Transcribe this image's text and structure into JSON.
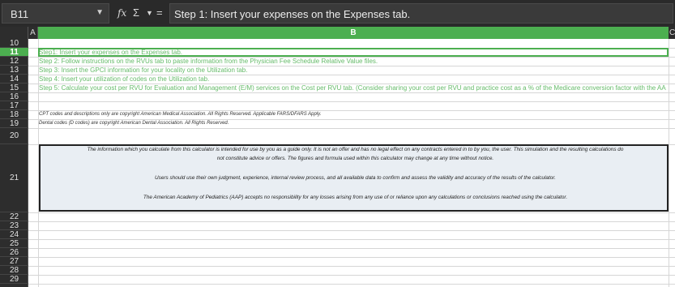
{
  "formula_bar": {
    "name_box": "B11",
    "content": "Step 1: Insert your expenses on the Expenses tab."
  },
  "columns": [
    "A",
    "B",
    "C"
  ],
  "rows": [
    "10",
    "11",
    "12",
    "13",
    "14",
    "15",
    "16",
    "17",
    "18",
    "19",
    "20",
    "21",
    "22",
    "23",
    "24",
    "25",
    "26",
    "27",
    "28",
    "29"
  ],
  "selected_row": "11",
  "cells": {
    "r11": "Step1: Insert your expenses on the Expenses tab.",
    "r12": "Step 2: Follow instructions on the RVUs tab to paste information from the Physician Fee Schedule Relative Value files.",
    "r13": "Step 3: Insert the GPCI information for your locality on the Utilization tab.",
    "r14": "Step 4: Insert your utilization of codes on the Utilization tab.",
    "r15": "Step 5: Calculate your cost per RVU for Evaluation and Management (E/M) services on the Cost per RVU tab. (Consider sharing your cost per RVU and practice cost as a % of the Medicare conversion factor with the AA",
    "r18": "CPT codes and descriptions only are copyright American Medical Association. All Rights Reserved. Applicable FARS/DFARS Apply.",
    "r19": "Dental codes (D codes) are copyright American Dental Association. All Rights Reserved.",
    "disclaimer_1a": "The information which you calculate from this calculator is intended for use by you as a guide only. It is not an offer and has no legal effect on any contracts entered in to by you, the user. This simulation and the resulting calculations do",
    "disclaimer_1b": "not constitute advice or offers. The figures and formula used within this calculator may change at any time without notice.",
    "disclaimer_2": "Users should use their own judgment, experience, internal review process, and all available data to confirm and assess the validity and accuracy of the results of the calculator.",
    "disclaimer_3": "The American Academy of Pediatrics (AAP) accepts no responsibility for any losses arising from any use of or reliance upon any calculations or conclusions reached using the calculator."
  },
  "colors": {
    "accent": "#4caf50",
    "step_text": "#66bb6a",
    "disclaimer_bg": "#e9eef3"
  }
}
